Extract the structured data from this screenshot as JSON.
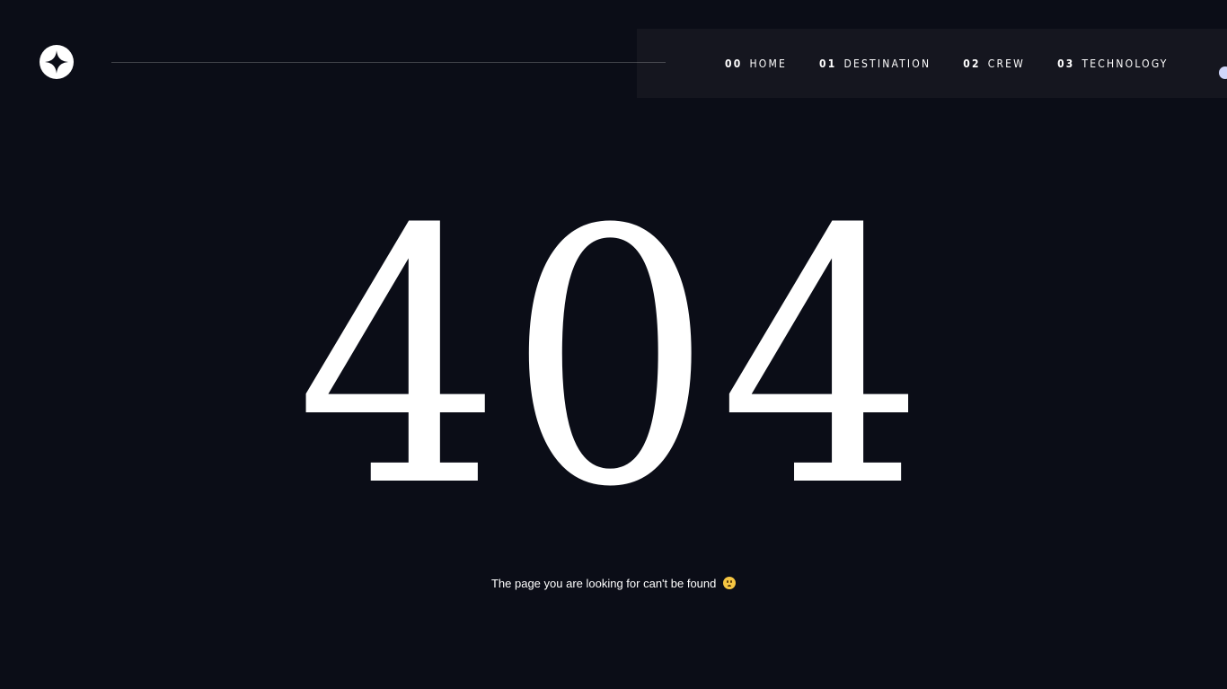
{
  "header": {
    "logo_icon": "star-logo-icon",
    "nav": {
      "items": [
        {
          "number": "00",
          "label": "HOME"
        },
        {
          "number": "01",
          "label": "DESTINATION"
        },
        {
          "number": "02",
          "label": "CREW"
        },
        {
          "number": "03",
          "label": "TECHNOLOGY"
        }
      ]
    }
  },
  "main": {
    "error_code": "404",
    "message": "The page you are looking for can't be found",
    "message_emoji": "worried-face-emoji"
  },
  "colors": {
    "background": "#0b0d17",
    "nav_background": "#15161f",
    "text": "#ffffff",
    "accent": "#d0d6f9"
  }
}
